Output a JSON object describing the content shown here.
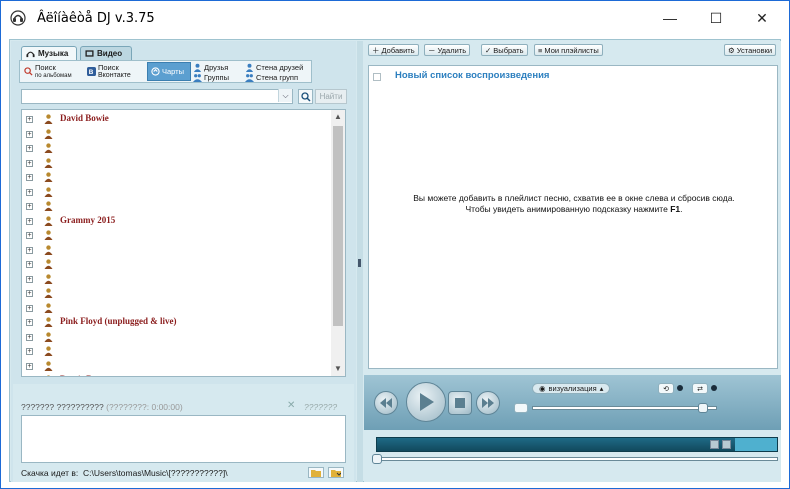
{
  "window": {
    "title": "Âëîíàêòå DJ v.3.75",
    "min_glyph": "—",
    "max_glyph": "☐",
    "close_glyph": "✕"
  },
  "tabs": [
    {
      "label": "Музыка",
      "icon": "headphones-icon"
    },
    {
      "label": "Видео",
      "icon": "film-icon"
    }
  ],
  "subtools": {
    "album_search_label": "Поиск",
    "album_search_sub": "по альбомам",
    "vk_search_label": "Поиск",
    "vk_search_sub": "Вконтакте",
    "charts_label": "Чарты",
    "friends_label": "Друзья",
    "groups_label": "Группы",
    "friends_wall_label": "Стена друзей",
    "groups_wall_label": "Стена групп"
  },
  "search": {
    "value": "",
    "find_label": "Найти",
    "combo_arrow": "⌵"
  },
  "tree": {
    "expand_glyph": "+",
    "artists": [
      "David Bowie",
      "Grammy 2015",
      "Pink Floyd (unplugged & live)",
      "Demis Roussos"
    ]
  },
  "download": {
    "status": "??????? ??????????",
    "sub": "(????????: 0:00:00)",
    "right_text": "???????",
    "close_glyph": "✕",
    "footer_prefix": "Скачка идет в:",
    "footer_path": "C:\\Users\\tomas\\Music\\[???????????]\\"
  },
  "playlist_toolbar": {
    "add": "Добавить",
    "delete": "Удалить",
    "select": "Выбрать",
    "my_playlists": "Мои плэйлисты",
    "settings": "Установки"
  },
  "playlist": {
    "title": "Новый список воспроизведения",
    "hint_line1": "Вы можете добавить в плейлист песню, схватив ее в окне слева и сбросив сюда.",
    "hint_line2": "Чтобы увидеть анимированную подсказку нажмите",
    "hint_key": "F1"
  },
  "player": {
    "visualization_label": "визуализация",
    "visualization_arrow": "▴",
    "volume_fraction": 0.95,
    "progress_fraction": 0.0
  },
  "colors": {
    "accent": "#2c7fbf",
    "artist": "#8b1d1d",
    "pane_bg": "#d6e9ef",
    "seek_dark": "#11495d"
  }
}
